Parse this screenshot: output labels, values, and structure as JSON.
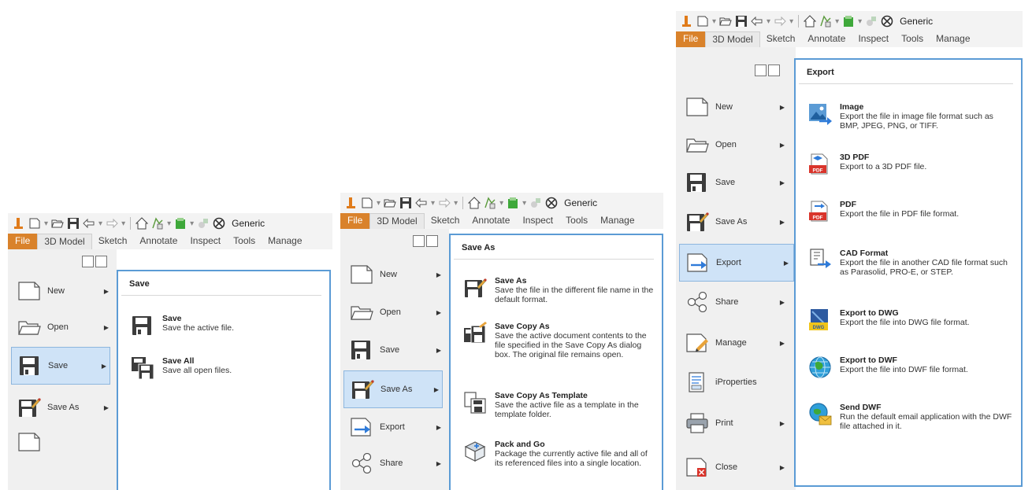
{
  "qat": {
    "project": "Generic"
  },
  "tabs": [
    "File",
    "3D Model",
    "Sketch",
    "Annotate",
    "Inspect",
    "Tools",
    "Manage"
  ],
  "panel1": {
    "menu": [
      "New",
      "Open",
      "Save",
      "Save As"
    ],
    "header": "Save",
    "items": [
      {
        "title": "Save",
        "desc": "Save the active file."
      },
      {
        "title": "Save All",
        "desc": "Save all open files."
      }
    ]
  },
  "panel2": {
    "menu": [
      "New",
      "Open",
      "Save",
      "Save As",
      "Export",
      "Share"
    ],
    "header": "Save As",
    "items": [
      {
        "title": "Save As",
        "desc": "Save the file in the different file name in the default format."
      },
      {
        "title": "Save Copy As",
        "desc": "Save the active document contents to the file specified in the Save Copy As dialog box. The original file remains open."
      },
      {
        "title": "Save Copy As Template",
        "desc": "Save the active file as a template in the template folder."
      },
      {
        "title": "Pack and Go",
        "desc": "Package the currently active file and all of its referenced files into a single location."
      }
    ]
  },
  "panel3": {
    "menu": [
      "New",
      "Open",
      "Save",
      "Save As",
      "Export",
      "Share",
      "Manage",
      "iProperties",
      "Print",
      "Close"
    ],
    "header": "Export",
    "items": [
      {
        "title": "Image",
        "desc": "Export the file in image file format such as BMP, JPEG, PNG, or TIFF."
      },
      {
        "title": "3D PDF",
        "desc": "Export to a 3D PDF file.",
        "badge": "PDF"
      },
      {
        "title": "PDF",
        "desc": "Export the file in PDF file format.",
        "badge": "PDF"
      },
      {
        "title": "CAD Format",
        "desc": "Export the file in another CAD file format such as Parasolid, PRO-E, or STEP."
      },
      {
        "title": "Export to DWG",
        "desc": "Export the file into DWG file format.",
        "badge": "DWG"
      },
      {
        "title": "Export to DWF",
        "desc": "Export the file into DWF file format."
      },
      {
        "title": "Send DWF",
        "desc": "Run the default email application with the DWF file attached in it."
      }
    ]
  },
  "colors": {
    "file_tab": "#d9822b",
    "selection": "#cfe3f7",
    "selection_border": "#8db6de",
    "panel_border": "#5b9bd5",
    "menu_bg": "#f0f0f0"
  },
  "icons": [
    "app-logo-icon",
    "new-file-icon",
    "open-folder-icon",
    "save-disk-icon",
    "undo-icon",
    "redo-icon",
    "home-icon",
    "project-icon",
    "material-icon",
    "appearance-icon",
    "clear-appearance-icon"
  ]
}
